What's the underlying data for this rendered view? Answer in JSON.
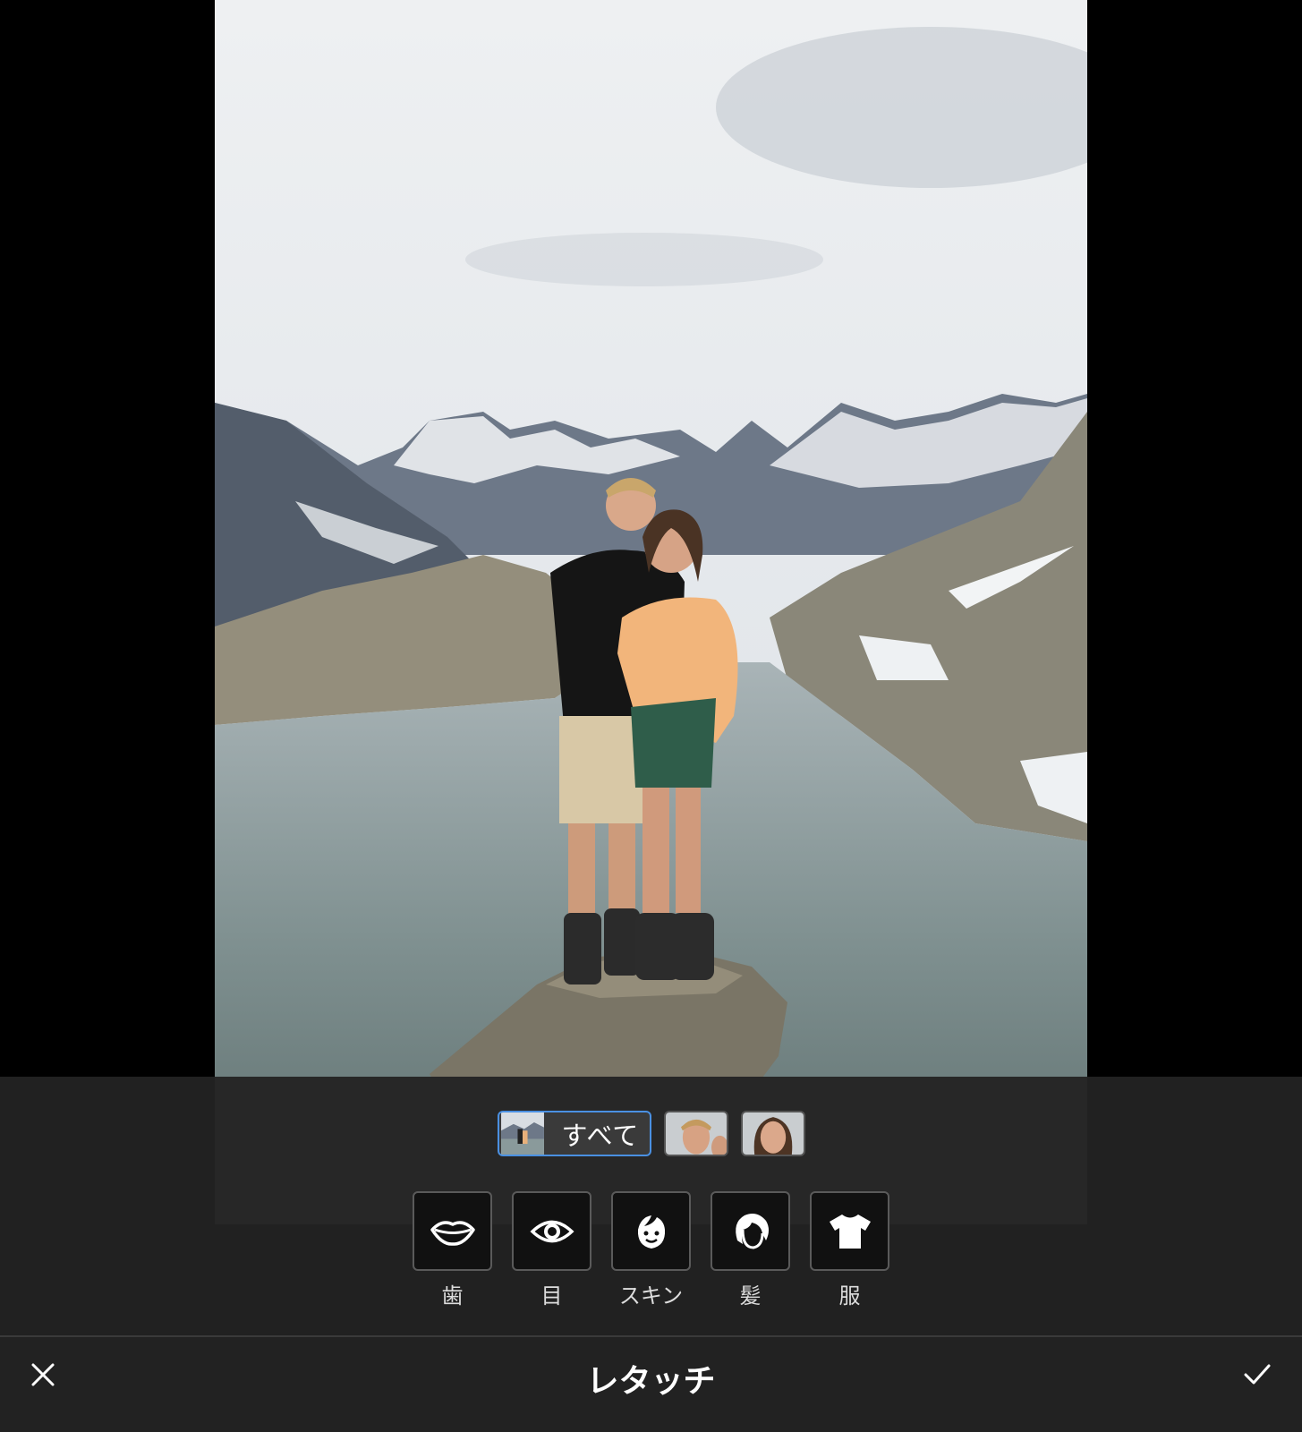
{
  "screen": {
    "title": "レタッチ"
  },
  "targets": [
    {
      "id": "all",
      "label": "すべて",
      "selected": true
    },
    {
      "id": "face-1",
      "label": "",
      "selected": false
    },
    {
      "id": "face-2",
      "label": "",
      "selected": false
    }
  ],
  "tools": [
    {
      "id": "teeth",
      "label": "歯",
      "icon": "lips-icon"
    },
    {
      "id": "eyes",
      "label": "目",
      "icon": "eye-icon"
    },
    {
      "id": "skin",
      "label": "スキン",
      "icon": "face-icon"
    },
    {
      "id": "hair",
      "label": "髪",
      "icon": "hair-icon"
    },
    {
      "id": "clothes",
      "label": "服",
      "icon": "shirt-icon"
    }
  ],
  "colors": {
    "accent": "#4a90e2",
    "panel": "#222222",
    "background": "#000000"
  }
}
